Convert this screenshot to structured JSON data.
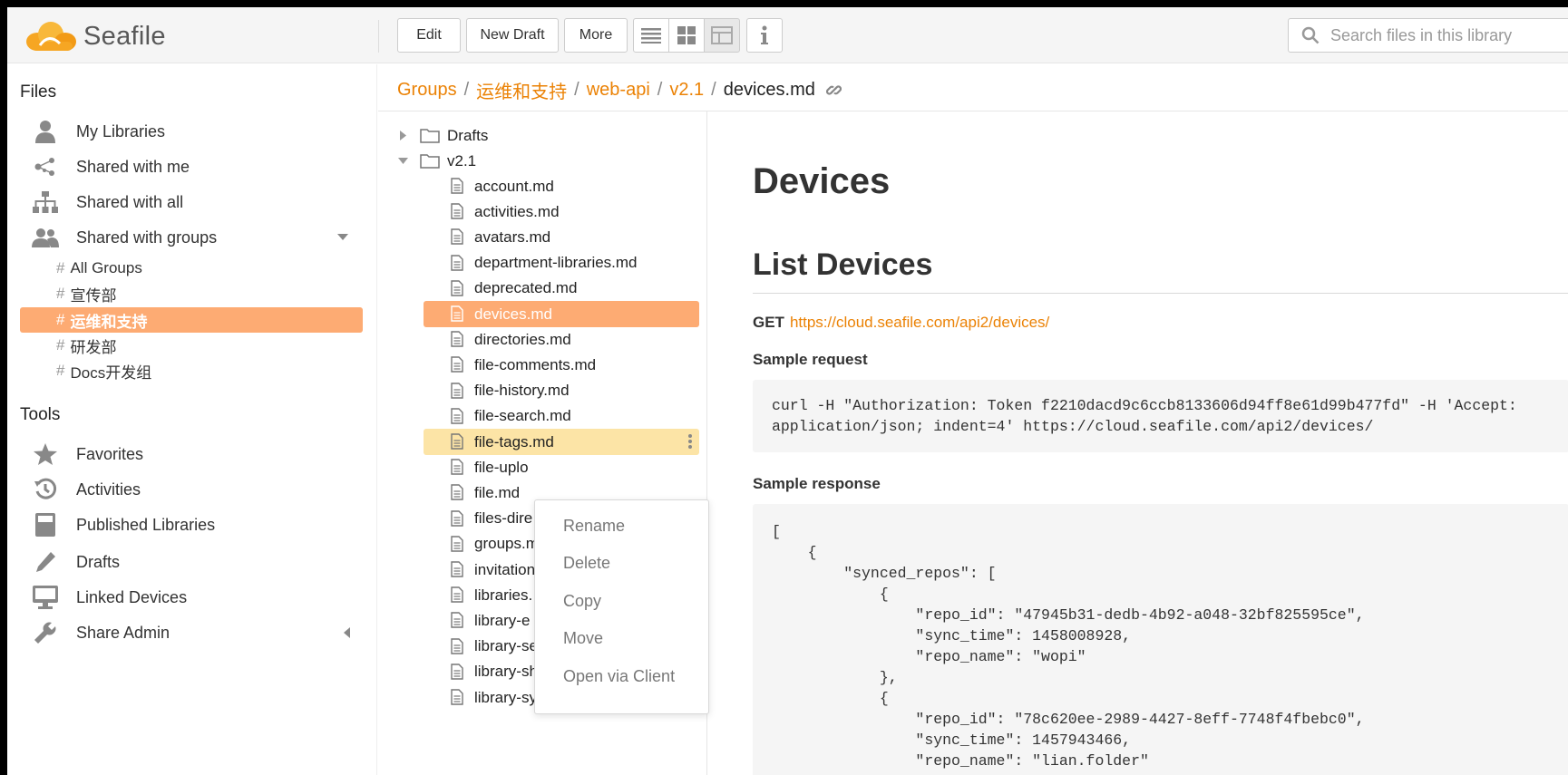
{
  "app": {
    "logo_text": "Seafile"
  },
  "toolbar": {
    "edit_label": "Edit",
    "new_draft_label": "New Draft",
    "more_label": "More"
  },
  "search": {
    "placeholder": "Search files in this library"
  },
  "sidebar": {
    "files_heading": "Files",
    "items": [
      {
        "label": "My Libraries",
        "icon": "user-icon"
      },
      {
        "label": "Shared with me",
        "icon": "share-icon"
      },
      {
        "label": "Shared with all",
        "icon": "org-chart-icon"
      },
      {
        "label": "Shared with groups",
        "icon": "group-icon"
      }
    ],
    "groups": [
      {
        "label": "All Groups",
        "active": false
      },
      {
        "label": "宣传部",
        "active": false
      },
      {
        "label": "运维和支持",
        "active": true
      },
      {
        "label": "研发部",
        "active": false
      },
      {
        "label": "Docs开发组",
        "active": false
      }
    ],
    "tools_heading": "Tools",
    "tools": [
      {
        "label": "Favorites",
        "icon": "star-icon"
      },
      {
        "label": "Activities",
        "icon": "history-icon"
      },
      {
        "label": "Published Libraries",
        "icon": "book-icon"
      },
      {
        "label": "Drafts",
        "icon": "pencil-icon"
      },
      {
        "label": "Linked Devices",
        "icon": "monitor-icon"
      },
      {
        "label": "Share Admin",
        "icon": "wrench-icon"
      }
    ]
  },
  "breadcrumb": {
    "items": [
      "Groups",
      "运维和支持",
      "web-api",
      "v2.1"
    ],
    "current": "devices.md"
  },
  "tree": {
    "folders": [
      "Drafts",
      "v2.1"
    ],
    "files": [
      "account.md",
      "activities.md",
      "avatars.md",
      "department-libraries.md",
      "deprecated.md",
      "devices.md",
      "directories.md",
      "file-comments.md",
      "file-history.md",
      "file-search.md",
      "file-tags.md",
      "file-uplo",
      "file.md",
      "files-dire",
      "groups.m",
      "invitation",
      "libraries.",
      "library-e",
      "library-search.md",
      "library-shared-with-all.md",
      "library-sync.md"
    ],
    "selected": "devices.md",
    "hovered": "file-tags.md"
  },
  "context_menu": {
    "items": [
      "Rename",
      "Delete",
      "Copy",
      "Move",
      "Open via Client"
    ]
  },
  "doc": {
    "title": "Devices",
    "section_title": "List Devices",
    "method": "GET",
    "url": "https://cloud.seafile.com/api2/devices/",
    "sample_request_label": "Sample request",
    "sample_request_code": "curl -H \"Authorization: Token f2210dacd9c6ccb8133606d94ff8e61d99b477fd\" -H 'Accept:\napplication/json; indent=4' https://cloud.seafile.com/api2/devices/",
    "sample_response_label": "Sample response",
    "sample_response_code": "[\n    {\n        \"synced_repos\": [\n            {\n                \"repo_id\": \"47945b31-dedb-4b92-a048-32bf825595ce\",\n                \"sync_time\": 1458008928,\n                \"repo_name\": \"wopi\"\n            },\n            {\n                \"repo_id\": \"78c620ee-2989-4427-8eff-7748f4fbebc0\",\n                \"sync_time\": 1457943466,\n                \"repo_name\": \"lian.folder\""
  },
  "colors": {
    "accent": "#eb8205",
    "active_bg": "#fdab73",
    "hover_bg": "#fce4a6"
  }
}
